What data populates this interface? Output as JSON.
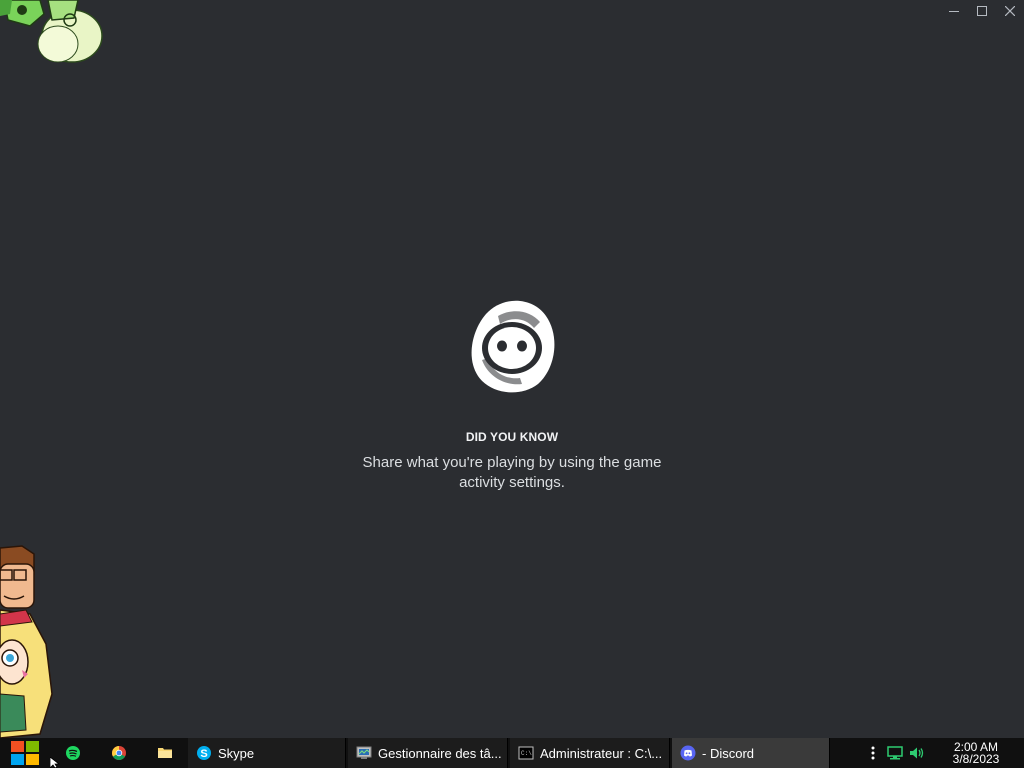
{
  "window": {
    "controls": [
      "minimize",
      "maximize",
      "close"
    ]
  },
  "loading": {
    "heading": "DID YOU KNOW",
    "tip": "Share what you're playing by using the game activity settings."
  },
  "taskbar": {
    "pinned": [
      {
        "name": "spotify-icon"
      },
      {
        "name": "chrome-icon"
      },
      {
        "name": "file-explorer-icon"
      }
    ],
    "tasks": [
      {
        "label": "Skype",
        "icon": "skype-icon"
      },
      {
        "label": "Gestionnaire des tâ...",
        "icon": "task-manager-icon"
      },
      {
        "label": "Administrateur : C:\\...",
        "icon": "cmd-icon"
      },
      {
        "label": "- Discord",
        "icon": "discord-icon"
      }
    ],
    "clock": {
      "time": "2:00 AM",
      "date": "3/8/2023"
    }
  },
  "colors": {
    "background": "#2b2d31",
    "taskbar": "#101010",
    "discord_blurple": "#5865f2",
    "spotify_green": "#1ed760"
  }
}
